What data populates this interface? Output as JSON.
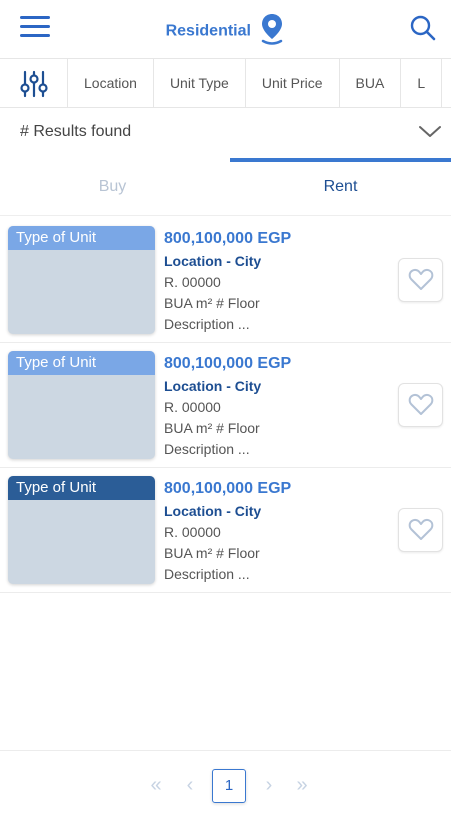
{
  "header": {
    "title": "Residential",
    "menu_icon": "hamburger-icon",
    "search_icon": "search-icon",
    "location_icon": "map-pin-icon"
  },
  "filters": {
    "icon": "sliders-icon",
    "chips": [
      "Location",
      "Unit Type",
      "Unit Price",
      "BUA",
      "L"
    ]
  },
  "results": {
    "text": "# Results found"
  },
  "tabs": {
    "buy": "Buy",
    "rent": "Rent",
    "active": "rent"
  },
  "listings": [
    {
      "tag": "Type of Unit",
      "tag_color": "#7aa7e6",
      "price": "800,100,000 EGP",
      "location": "Location - City",
      "ref": "R. 00000",
      "bua": "BUA m²  # Floor",
      "description": "Description ..."
    },
    {
      "tag": "Type of Unit",
      "tag_color": "#7aa7e6",
      "price": "800,100,000 EGP",
      "location": "Location - City",
      "ref": "R. 00000",
      "bua": "BUA m²  # Floor",
      "description": "Description ..."
    },
    {
      "tag": "Type of Unit",
      "tag_color": "#2b5d97",
      "price": "800,100,000 EGP",
      "location": "Location - City",
      "ref": "R. 00000",
      "bua": "BUA m²  # Floor",
      "description": "Description ..."
    }
  ],
  "pagination": {
    "first": "«",
    "prev": "‹",
    "current": "1",
    "next": "›",
    "last": "»"
  },
  "colors": {
    "accent": "#3a78d0",
    "dark_blue": "#1d4e92"
  }
}
